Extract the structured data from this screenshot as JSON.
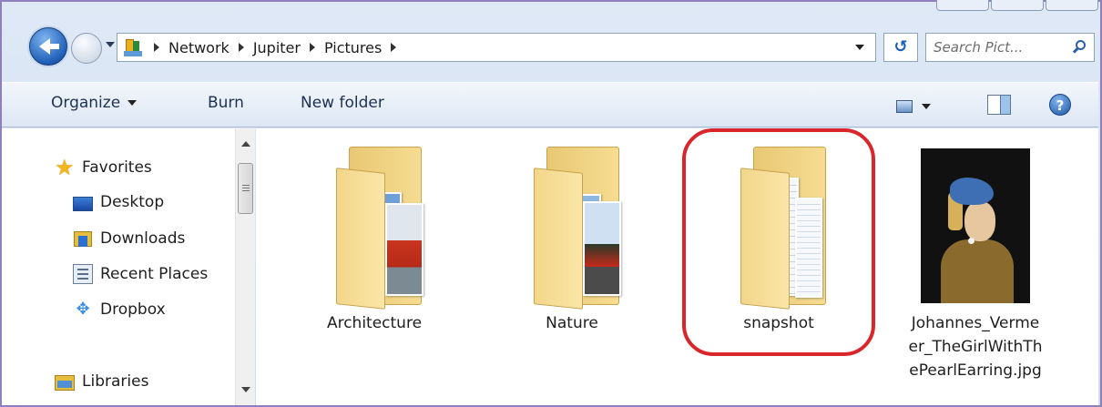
{
  "window": {
    "title_hidden": ""
  },
  "navigation": {
    "breadcrumbs": [
      "Network",
      "Jupiter",
      "Pictures"
    ]
  },
  "search": {
    "placeholder": "Search Pict..."
  },
  "toolbar": {
    "organize_label": "Organize",
    "burn_label": "Burn",
    "new_folder_label": "New folder",
    "help_glyph": "?"
  },
  "sidebar": {
    "items": [
      {
        "label": "Favorites",
        "icon": "star-icon"
      },
      {
        "label": "Desktop",
        "icon": "desktop-icon"
      },
      {
        "label": "Downloads",
        "icon": "downloads-icon"
      },
      {
        "label": "Recent Places",
        "icon": "recent-places-icon"
      },
      {
        "label": "Dropbox",
        "icon": "dropbox-icon"
      },
      {
        "label": "Libraries",
        "icon": "libraries-icon"
      }
    ]
  },
  "files": [
    {
      "name": "Architecture",
      "type": "folder"
    },
    {
      "name": "Nature",
      "type": "folder"
    },
    {
      "name": "snapshot",
      "type": "folder",
      "highlighted": true
    },
    {
      "name_lines": [
        "Johannes_Verme",
        "er_TheGirlWithTh",
        "ePearlEarring.jpg"
      ],
      "type": "image"
    }
  ],
  "colors": {
    "highlight_ring": "#d8262a",
    "accent": "#1f5fb8",
    "folder": "#f6dc92"
  }
}
